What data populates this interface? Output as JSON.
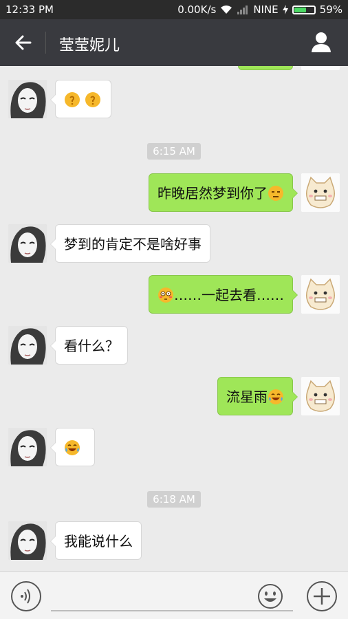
{
  "status_bar": {
    "time": "12:33 PM",
    "network": "0.00K/s",
    "carrier": "NINE",
    "battery": "59%",
    "battery_level": 0.59
  },
  "app_bar": {
    "title": "莹莹妮儿",
    "back_icon": "arrow-left-icon",
    "profile_icon": "person-icon"
  },
  "chat": {
    "messages": [
      {
        "type": "in",
        "text": "",
        "emoji": [
          "confused-emoji",
          "confused-emoji"
        ]
      },
      {
        "type": "timestamp",
        "text": "6:15 AM"
      },
      {
        "type": "out",
        "text": "昨晚居然梦到你了",
        "emoji_after": "unamused-emoji"
      },
      {
        "type": "in",
        "text": "梦到的肯定不是啥好事"
      },
      {
        "type": "out",
        "text": "……一起去看……",
        "emoji_before": "flushed-emoji"
      },
      {
        "type": "in",
        "text": "看什么？"
      },
      {
        "type": "out",
        "text": "流星雨",
        "emoji_after": "tears-of-joy-emoji"
      },
      {
        "type": "in",
        "text": "",
        "emoji": [
          "tears-of-joy-emoji"
        ]
      },
      {
        "type": "timestamp",
        "text": "6:18 AM"
      },
      {
        "type": "in",
        "text": "我能说什么"
      }
    ]
  },
  "input_bar": {
    "voice_icon": "voice-icon",
    "emoji_icon": "smiley-icon",
    "plus_icon": "plus-icon"
  },
  "colors": {
    "app_bar": "#393a3f",
    "outgoing_bubble": "#9fe658",
    "incoming_bubble": "#ffffff",
    "chat_bg": "#ebebeb"
  }
}
